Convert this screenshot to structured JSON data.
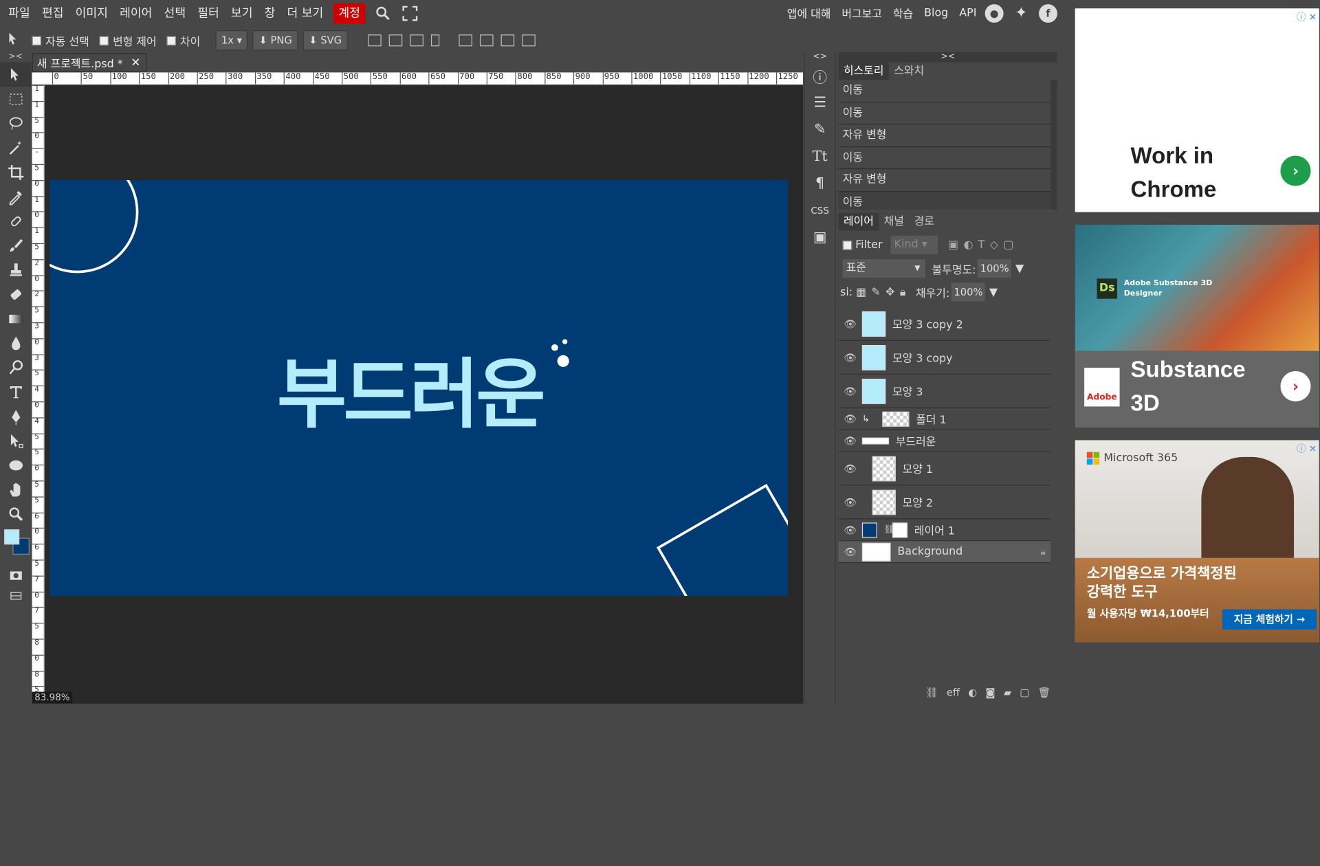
{
  "menu": {
    "items": [
      "파일",
      "편집",
      "이미지",
      "레이어",
      "선택",
      "필터",
      "보기",
      "창",
      "더 보기"
    ],
    "account": "계정",
    "right_links": [
      "앱에 대해",
      "버그보고",
      "학습",
      "Blog",
      "API"
    ]
  },
  "options": {
    "auto_select": "자동 선택",
    "transform": "변형 제어",
    "diff": "차이",
    "scale": "1x",
    "png": "PNG",
    "svg": "SVG"
  },
  "document": {
    "tab_title": "새 프로젝트.psd *",
    "zoom": "83.98%",
    "canvas_text": "부드러운"
  },
  "ruler": {
    "h_labels": [
      "0",
      "50",
      "100",
      "150",
      "200",
      "250",
      "300",
      "350",
      "400",
      "450",
      "500",
      "550",
      "600",
      "650",
      "700",
      "750",
      "800",
      "850",
      "900",
      "950",
      "1000",
      "1050",
      "1100",
      "1150",
      "1200",
      "1250"
    ],
    "v_labels": [
      "1",
      "1",
      "5",
      "0",
      "-",
      "5",
      "0",
      "1",
      "0",
      "1",
      "5",
      "2",
      "0",
      "2",
      "5",
      "3",
      "0",
      "3",
      "5",
      "4",
      "0",
      "4",
      "5",
      "5",
      "0",
      "5",
      "5",
      "6",
      "0",
      "6",
      "5",
      "7",
      "0",
      "7",
      "5",
      "8",
      "0",
      "8",
      "5"
    ]
  },
  "panel": {
    "tabs_top": [
      "히스토리",
      "스와치"
    ],
    "history": [
      "이동",
      "이동",
      "자유 변형",
      "이동",
      "자유 변형",
      "이동"
    ],
    "tabs_layers": [
      "레이어",
      "채널",
      "경로"
    ],
    "filter_label": "Filter",
    "kind": "Kind",
    "blend_mode": "표준",
    "opacity_label": "불투명도:",
    "opacity": "100%",
    "lock_label": "si:",
    "fill_label": "채우기:",
    "fill": "100%",
    "layers": [
      {
        "name": "모양 3 copy 2"
      },
      {
        "name": "모양 3 copy"
      },
      {
        "name": "모양 3"
      },
      {
        "name": "폴더 1"
      },
      {
        "name": "부드러운"
      },
      {
        "name": "모양 1"
      },
      {
        "name": "모양 2"
      },
      {
        "name": "레이어 1"
      },
      {
        "name": "Background"
      }
    ],
    "footer": [
      "eff"
    ]
  },
  "ads": {
    "ad1_title_line1": "Work in",
    "ad1_title_line2": "Chrome",
    "ad2_brand": "Adobe Substance 3D Designer",
    "ad2_title_line1": "Substance",
    "ad2_title_line2": "3D",
    "ad2_logo": "Adobe",
    "ad2_ds": "Ds",
    "ad3_brand": "Microsoft 365",
    "ad3_line1": "소기업용으로 가격책정된",
    "ad3_line2": "강력한 도구",
    "ad3_price": "월 사용자당 ₩14,100부터",
    "ad3_cta": "지금 체험하기 →"
  },
  "colors": {
    "foreground": "#b4ecfb",
    "background": "#003b73",
    "account": "#cc0000"
  }
}
